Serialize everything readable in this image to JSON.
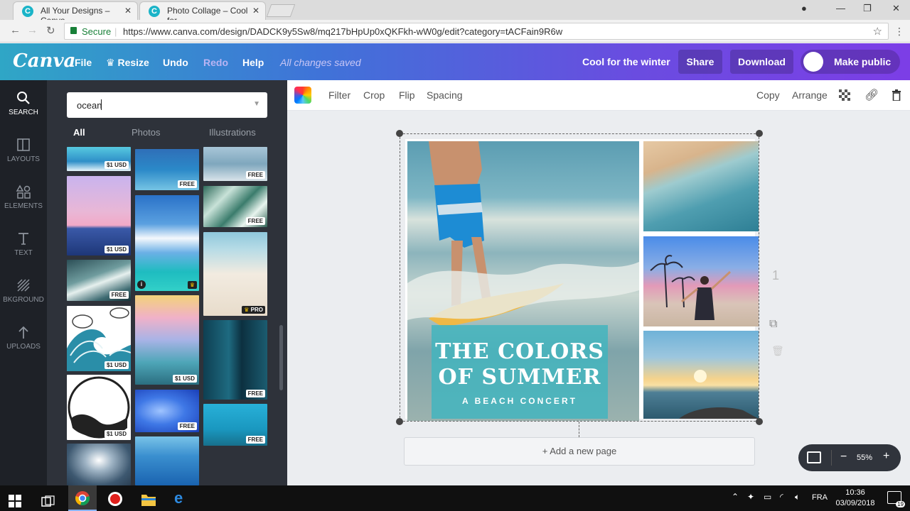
{
  "browser": {
    "tabs": [
      {
        "title": "All Your Designs – Canva",
        "favicon": "C"
      },
      {
        "title": "Photo Collage – Cool for",
        "favicon": "C"
      }
    ],
    "secure_label": "Secure",
    "url": "https://www.canva.com/design/DADCK9y5Sw8/mq217bHpUp0xQKFkh-wW0g/edit?category=tACFain9R6w"
  },
  "header": {
    "logo": "Canva",
    "menu": {
      "file": "File",
      "resize": "Resize",
      "undo": "Undo",
      "redo": "Redo",
      "help": "Help"
    },
    "saved_status": "All changes saved",
    "design_title": "Cool for the winter",
    "share": "Share",
    "download": "Download",
    "make_public": "Make public"
  },
  "rail": [
    {
      "label": "SEARCH",
      "icon": "search-icon"
    },
    {
      "label": "LAYOUTS",
      "icon": "layouts-icon"
    },
    {
      "label": "ELEMENTS",
      "icon": "elements-icon"
    },
    {
      "label": "TEXT",
      "icon": "text-icon"
    },
    {
      "label": "BKGROUND",
      "icon": "background-icon"
    },
    {
      "label": "UPLOADS",
      "icon": "uploads-icon"
    }
  ],
  "panel": {
    "search_value": "ocean",
    "tabs": [
      "All",
      "Photos",
      "Illustrations"
    ],
    "badges": {
      "usd": "$1 USD",
      "free": "FREE",
      "pro": "PRO"
    }
  },
  "toolbar": {
    "filter": "Filter",
    "crop": "Crop",
    "flip": "Flip",
    "spacing": "Spacing",
    "copy": "Copy",
    "arrange": "Arrange"
  },
  "canvas": {
    "headline_line1": "THE COLORS",
    "headline_line2": "OF SUMMER",
    "subline": "A BEACH CONCERT",
    "page_number": "1",
    "add_page": "+ Add a new page",
    "zoom": "55%"
  },
  "taskbar": {
    "language": "FRA",
    "time": "10:36",
    "date": "03/09/2018",
    "notifications": "19"
  },
  "colors": {
    "header_start": "#2fa6c6",
    "header_end": "#7c3ee6",
    "rail": "#1e2127",
    "panel": "#2e323a",
    "text_card": "#44b5be"
  }
}
